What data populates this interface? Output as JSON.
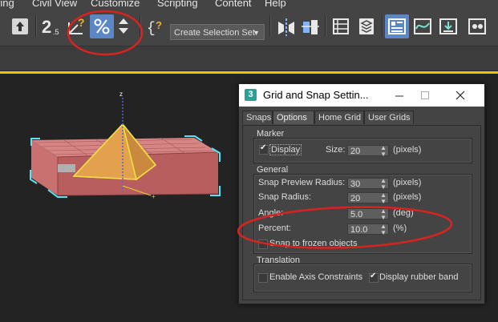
{
  "menu": [
    "ring",
    "Civil View",
    "Customize",
    "Scripting",
    "Content",
    "Help"
  ],
  "toolbar": {
    "selection_set_placeholder": "Create Selection Set",
    "icons": [
      "select-object-icon",
      "snaps-toggle-icon",
      "angle-snap-icon",
      "percent-snap-icon",
      "spinner-snap-icon",
      "named-selection-icon",
      "mirror-icon",
      "align-icon",
      "layer-explorer-icon",
      "scene-explorer-icon",
      "ribbon-icon",
      "curve-editor-icon",
      "schematic-view-icon",
      "material-editor-icon"
    ]
  },
  "viewport": {
    "gizmo_axis_label": "z"
  },
  "dialog": {
    "title": "Grid and Snap Settin...",
    "app_badge": "3",
    "tabs": [
      "Snaps",
      "Options",
      "Home Grid",
      "User Grids"
    ],
    "active_tab": "Options",
    "marker": {
      "group_label": "Marker",
      "display_label": "Display",
      "display_checked": true,
      "size_label": "Size:",
      "size_value": "20",
      "size_unit": "(pixels)"
    },
    "general": {
      "group_label": "General",
      "snap_preview_radius_label": "Snap Preview Radius:",
      "snap_preview_radius_value": "30",
      "snap_preview_radius_unit": "(pixels)",
      "snap_radius_label": "Snap Radius:",
      "snap_radius_value": "20",
      "snap_radius_unit": "(pixels)",
      "angle_label": "Angle:",
      "angle_value": "5.0",
      "angle_unit": "(deg)",
      "percent_label": "Percent:",
      "percent_value": "10.0",
      "percent_unit": "(%)",
      "snap_frozen_label": "Snap to frozen objects",
      "snap_frozen_checked": false
    },
    "translation": {
      "group_label": "Translation",
      "enable_axis_label": "Enable Axis Constraints",
      "enable_axis_checked": false,
      "rubber_band_label": "Display rubber band",
      "rubber_band_checked": true
    }
  },
  "colors": {
    "accent": "#5b87c6",
    "annotation_red": "#d9231f",
    "box_face": "#c96b6b",
    "selection_cyan": "#57e3ef",
    "viewport_border": "#f2c400"
  }
}
